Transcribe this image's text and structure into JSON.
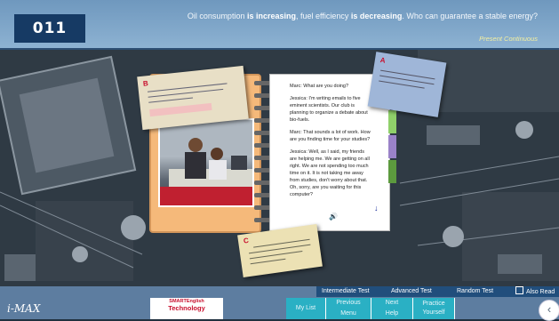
{
  "header": {
    "lesson_number": "011",
    "question_before_1": "Oil consumption ",
    "question_bold_1": "is increasing",
    "question_mid": ", fuel efficiency ",
    "question_bold_2": "is decreasing",
    "question_after": ". Who can guarantee a stable energy?",
    "grammar_topic": "Present Continuous"
  },
  "notes": {
    "b_tag": "B",
    "a_tag": "A",
    "c_tag": "C"
  },
  "dialog": [
    {
      "text": "Marc: What are you doing?"
    },
    {
      "text": "Jessica: I'm writing emails to five eminent scientists. Our club is planning to organize a debate about bio-fuels."
    },
    {
      "text": "Marc: That sounds a lot of work. How are you finding time for your studies?"
    },
    {
      "text": "Jessica: Well, as I said, my friends are helping me. We are getting on all right. We are not spending too much time on it. It is not taking me away from studies, don't worry about that. Oh, sorry, are you waiting for this computer?"
    }
  ],
  "menu": {
    "intermediate": "Intermediate Test",
    "advanced": "Advanced Test",
    "random": "Random Test",
    "also_read": "Also Read",
    "also_read_icon": "list-icon"
  },
  "bottom": {
    "logo": "i-MAX",
    "brand_line1": "SMARTEnglish",
    "brand_line2": "Technology",
    "my_list": "My List",
    "previous": "Previous",
    "menu": "Menu",
    "next": "Next",
    "help": "Help",
    "practice": "Practice Yourself",
    "back_icon": "chevron-left-icon"
  },
  "colors": {
    "header_bg": "#7ea6ca",
    "lesson_badge": "#163a64",
    "menu_strip": "#214e7c",
    "nav_button": "#2ab0c4",
    "accent_red": "#c8102e"
  }
}
